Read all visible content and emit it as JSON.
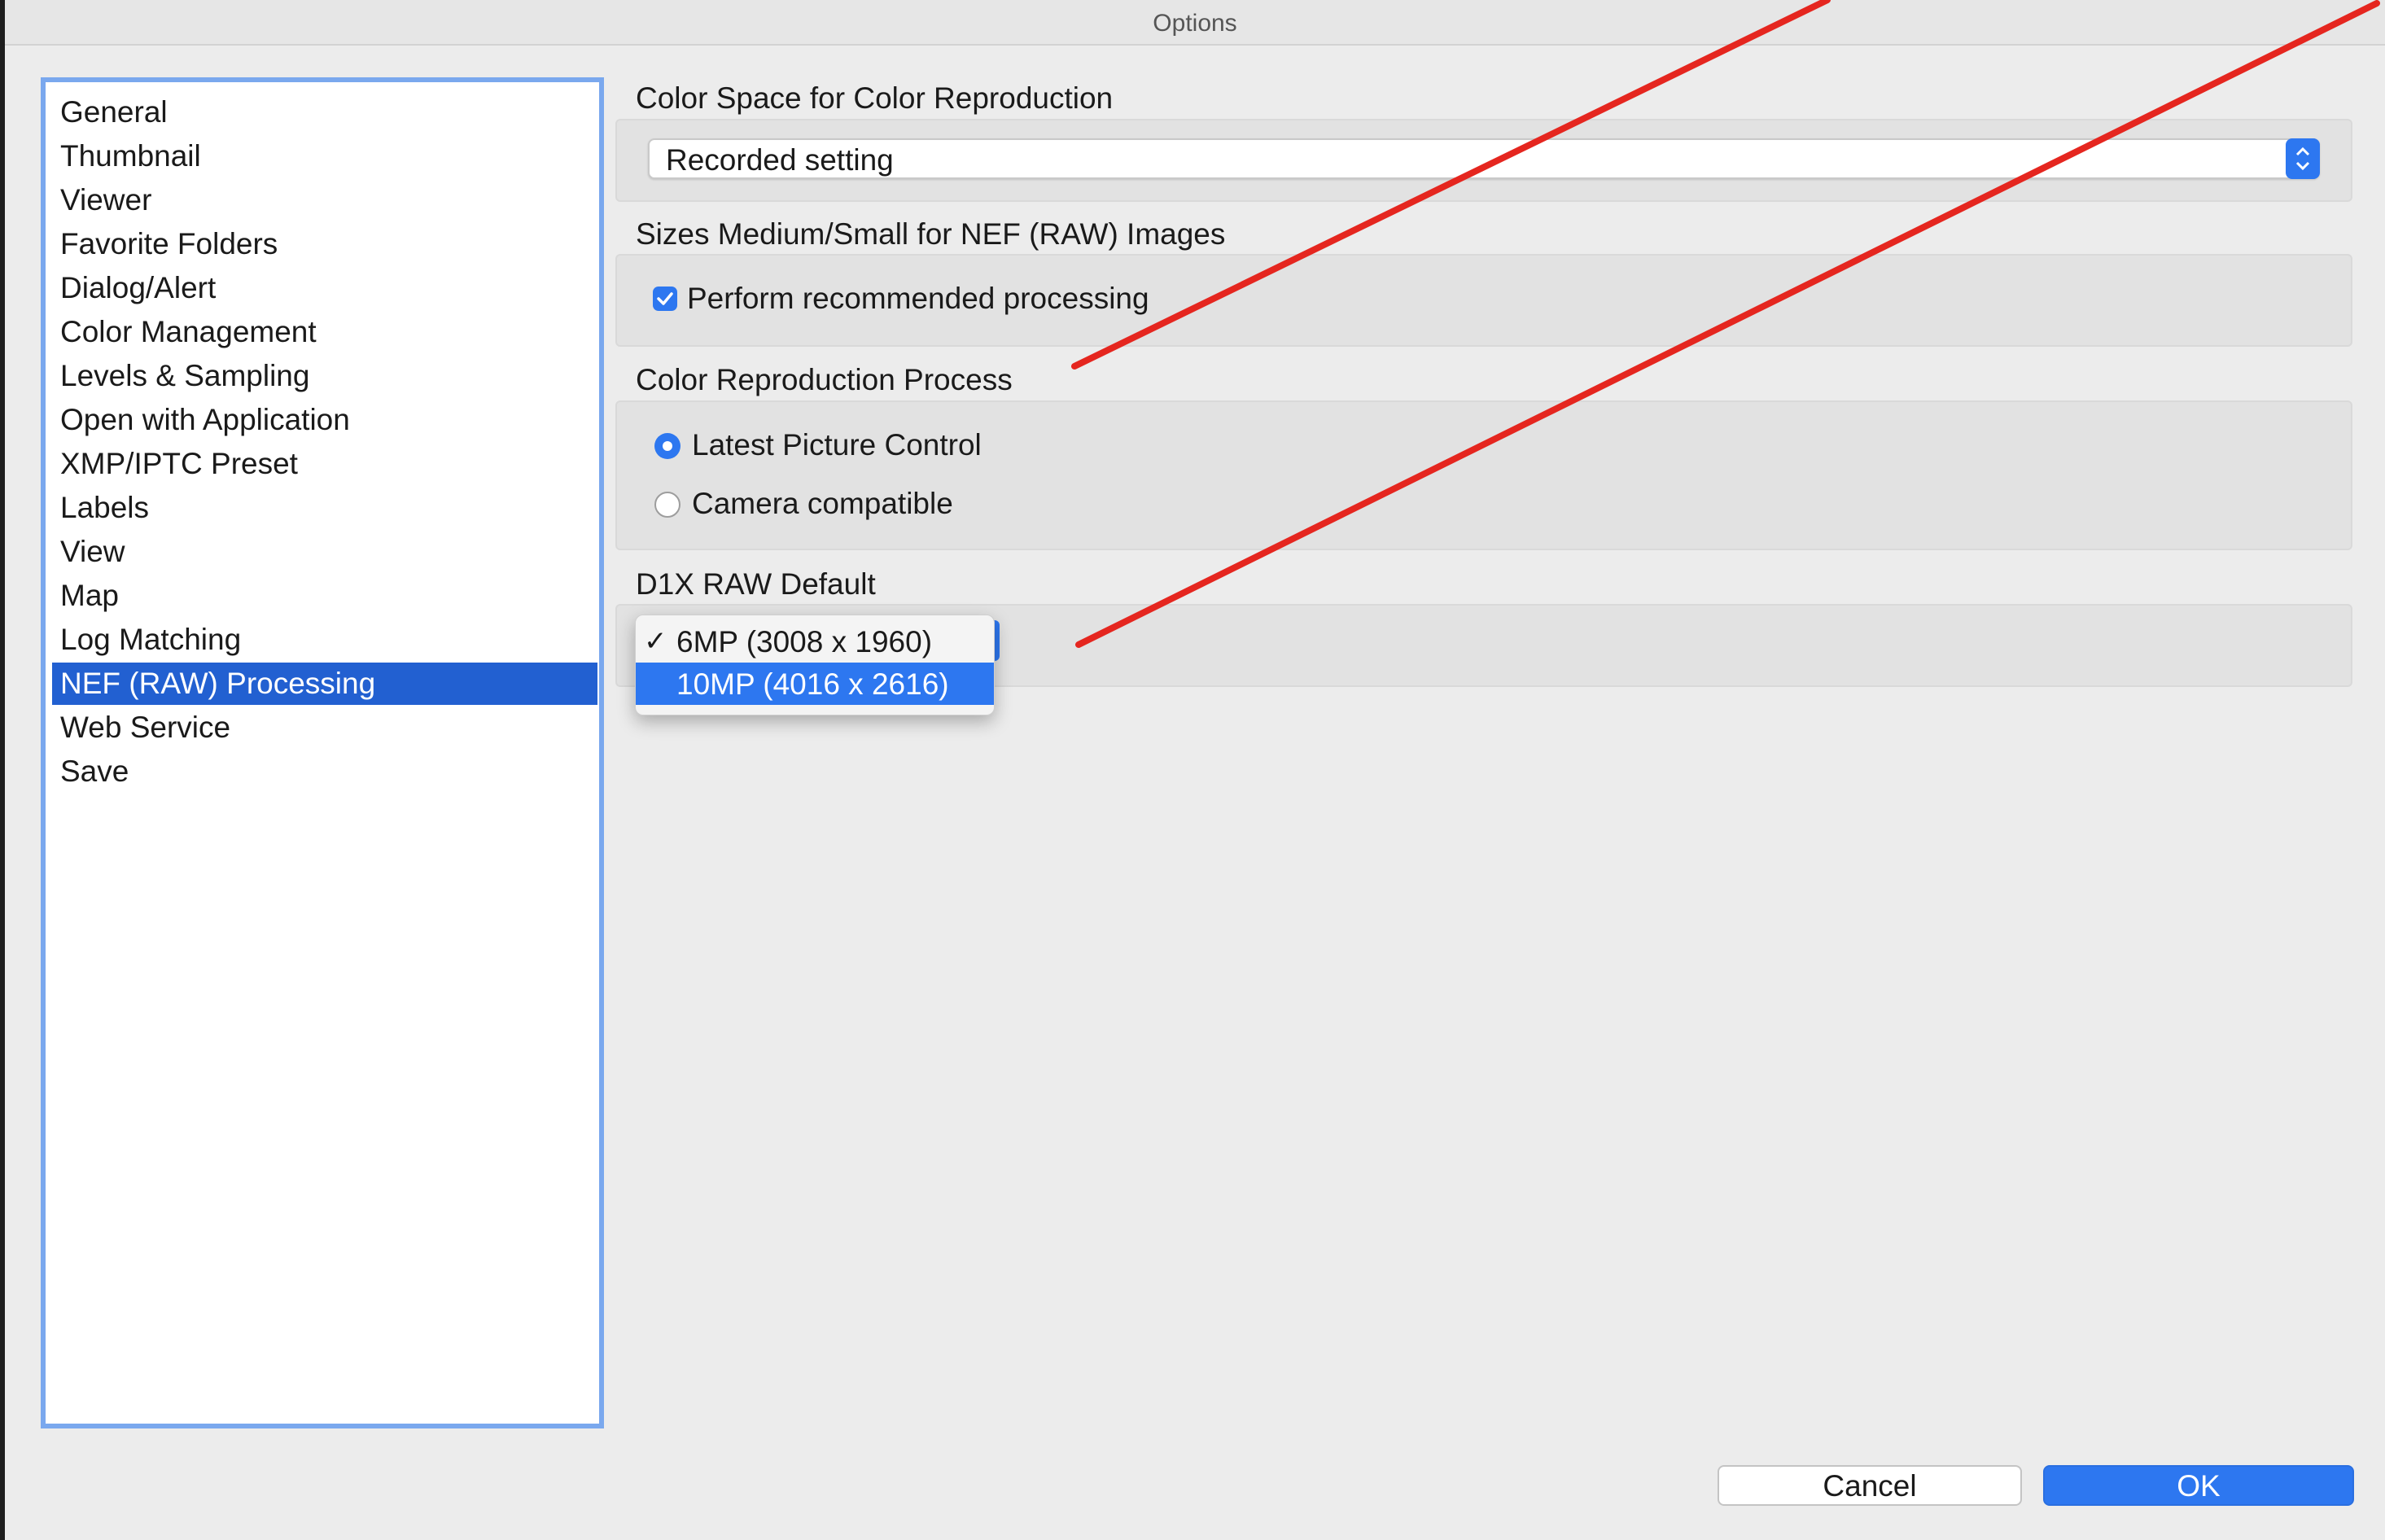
{
  "window": {
    "title": "Options"
  },
  "sidebar": {
    "items": [
      {
        "label": "General"
      },
      {
        "label": "Thumbnail"
      },
      {
        "label": "Viewer"
      },
      {
        "label": "Favorite Folders"
      },
      {
        "label": "Dialog/Alert"
      },
      {
        "label": "Color Management"
      },
      {
        "label": "Levels & Sampling"
      },
      {
        "label": "Open with Application"
      },
      {
        "label": "XMP/IPTC Preset"
      },
      {
        "label": "Labels"
      },
      {
        "label": "View"
      },
      {
        "label": "Map"
      },
      {
        "label": "Log Matching"
      },
      {
        "label": "NEF (RAW) Processing"
      },
      {
        "label": "Web Service"
      },
      {
        "label": "Save"
      }
    ],
    "selected": "NEF (RAW) Processing"
  },
  "color_space": {
    "label": "Color Space for Color Reproduction",
    "value": "Recorded setting"
  },
  "sizes": {
    "label": "Sizes Medium/Small for NEF (RAW) Images",
    "checkbox_label": "Perform recommended processing",
    "checked": true
  },
  "reproduction": {
    "label": "Color Reproduction Process",
    "options": [
      "Latest Picture Control",
      "Camera compatible"
    ],
    "selected": "Latest Picture Control"
  },
  "d1x": {
    "label": "D1X RAW Default",
    "menu": [
      {
        "check": "✓",
        "label": "6MP (3008 x 1960)"
      },
      {
        "check": "",
        "label": "10MP (4016 x 2616)"
      }
    ],
    "selected": "6MP (3008 x 1960)",
    "highlighted": "10MP (4016 x 2616)"
  },
  "buttons": {
    "cancel": "Cancel",
    "ok": "OK"
  },
  "colors": {
    "accent": "#2d77f0",
    "selection": "#2260d1",
    "annotation": "#e5261f"
  },
  "icons": {
    "checkbox": "checkmark-icon",
    "popup": "updown-chevron-icon"
  }
}
